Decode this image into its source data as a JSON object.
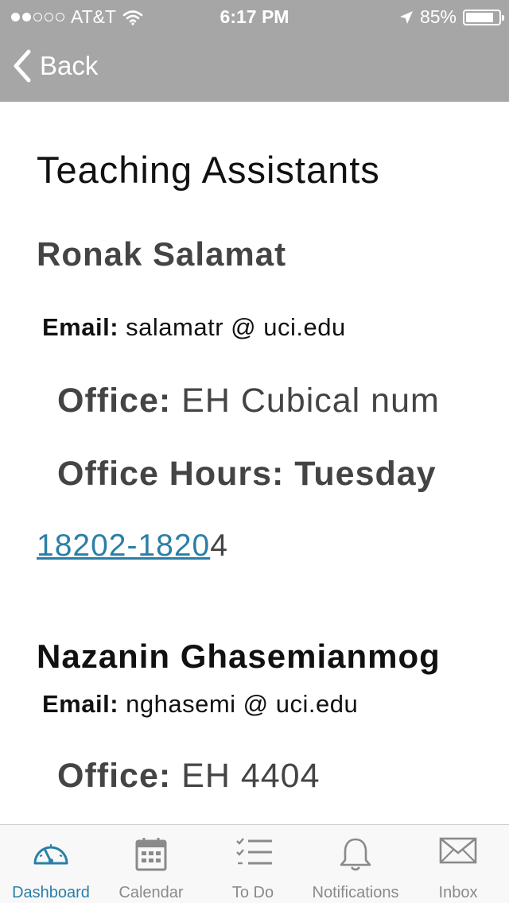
{
  "status_bar": {
    "carrier": "AT&T",
    "time": "6:17 PM",
    "battery": "85%",
    "battery_level": 0.85,
    "signal_bars_filled": 2,
    "signal_bars_total": 5
  },
  "nav": {
    "back_label": "Back"
  },
  "page": {
    "title": "Teaching Assistants"
  },
  "assistants": [
    {
      "name": "Ronak Salamat",
      "email_label": "Email:",
      "email": "salamatr @ uci.edu",
      "office_label": "Office:",
      "office": "EH Cubical num",
      "hours_label": "Office Hours: Tuesday",
      "phone_link": "18202-1820",
      "phone_rest": "4"
    },
    {
      "name": "Nazanin Ghasemianmog",
      "email_label": "Email:",
      "email": "nghasemi @ uci.edu",
      "office_label": "Office:",
      "office": "EH 4404"
    }
  ],
  "tabbar": {
    "items": [
      {
        "label": "Dashboard",
        "icon": "dashboard-gauge-icon",
        "active": true
      },
      {
        "label": "Calendar",
        "icon": "calendar-icon",
        "active": false
      },
      {
        "label": "To Do",
        "icon": "todo-list-icon",
        "active": false
      },
      {
        "label": "Notifications",
        "icon": "bell-icon",
        "active": false
      },
      {
        "label": "Inbox",
        "icon": "envelope-icon",
        "active": false
      }
    ]
  },
  "colors": {
    "nav_bar": "#a6a6a6",
    "accent": "#2a7fa8",
    "inactive_tab": "#8a8a8a"
  }
}
